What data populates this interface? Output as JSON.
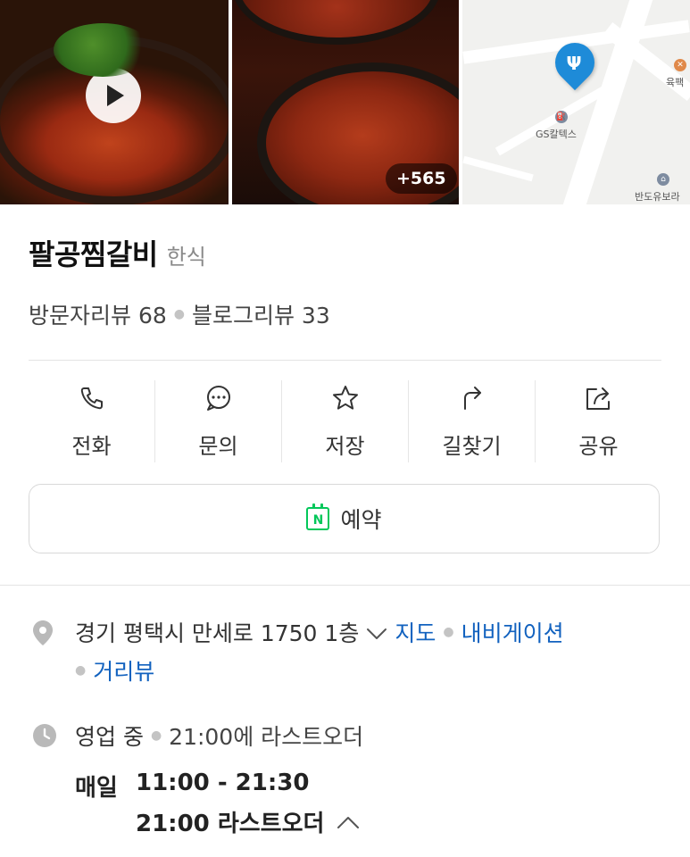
{
  "photos": {
    "more_count": "+565",
    "map_labels": {
      "gas_station": "GS칼텍스",
      "top_right": "육팩",
      "bottom_right": "반도유보라"
    }
  },
  "place": {
    "name": "팔공찜갈비",
    "category": "한식",
    "visitor_reviews": "방문자리뷰 68",
    "blog_reviews": "블로그리뷰 33"
  },
  "actions": [
    {
      "label": "전화",
      "icon": "phone-icon"
    },
    {
      "label": "문의",
      "icon": "chat-bubble-icon"
    },
    {
      "label": "저장",
      "icon": "star-icon"
    },
    {
      "label": "길찾기",
      "icon": "directions-arrow-icon"
    },
    {
      "label": "공유",
      "icon": "share-icon"
    }
  ],
  "reserve": {
    "label": "예약",
    "icon_letter": "N",
    "accent": "#03c75a"
  },
  "address": {
    "text": "경기 평택시 만세로 1750 1층",
    "links": [
      "지도",
      "내비게이션",
      "거리뷰"
    ],
    "link_color": "#1262bf"
  },
  "hours": {
    "status": "영업 중",
    "last_order_note": "21:00에 라스트오더",
    "day": "매일",
    "time": "11:00 - 21:30",
    "last_order": "21:00 라스트오더"
  }
}
